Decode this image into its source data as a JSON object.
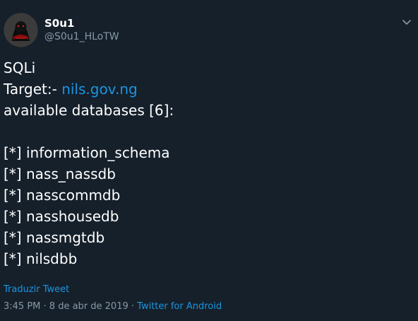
{
  "author": {
    "display_name": "S0u1",
    "username": "@S0u1_HLoTW"
  },
  "tweet": {
    "line1": "SQLi",
    "target_prefix": "Target:- ",
    "target_link": "nils.gov.ng",
    "databases_heading": "available databases [6]:",
    "databases": [
      "[*] information_schema",
      "[*] nass_nassdb",
      "[*] nasscommdb",
      "[*] nasshousedb",
      "[*] nassmgtdb",
      "[*] nilsdbb"
    ]
  },
  "translate_label": "Traduzir Tweet",
  "meta": {
    "time": "3:45 PM",
    "separator": " · ",
    "date": "8 de abr de 2019",
    "source": "Twitter for Android"
  },
  "icons": {
    "menu": "chevron-down-icon",
    "avatar": "avatar-image"
  },
  "colors": {
    "background": "#15202b",
    "text": "#ffffff",
    "secondary": "#8899a6",
    "link": "#1b95e0"
  }
}
